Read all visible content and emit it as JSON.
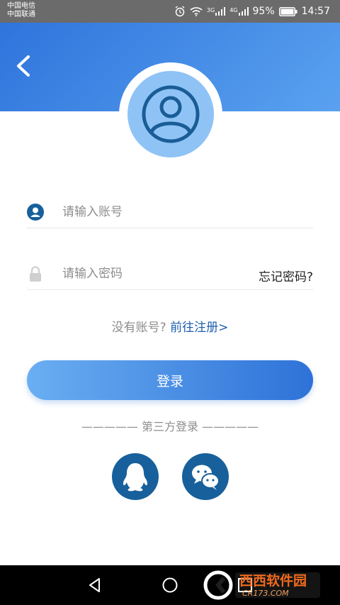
{
  "status_bar": {
    "carrier1": "中国电信",
    "carrier2": "中国联通",
    "network1": "3G",
    "network2": "4G",
    "battery": "95%",
    "time": "14:57"
  },
  "header": {
    "back_icon": "chevron-left-icon"
  },
  "avatar": {
    "icon": "user-avatar-icon"
  },
  "form": {
    "account_placeholder": "请输入账号",
    "password_placeholder": "请输入密码",
    "forgot_label": "忘记密码?"
  },
  "register": {
    "question": "没有账号?",
    "link": "前往注册>"
  },
  "login_button": "登录",
  "third_party": {
    "label": "————— 第三方登录 —————"
  },
  "social": [
    "qq-icon",
    "wechat-icon"
  ],
  "nav": [
    "back-icon",
    "home-icon",
    "recents-icon"
  ],
  "watermark": {
    "text": "西西软件园",
    "site": "CR173.COM"
  },
  "colors": {
    "primary": "#2e72d8",
    "accent_dark": "#17609b",
    "link": "#1f5fae"
  }
}
